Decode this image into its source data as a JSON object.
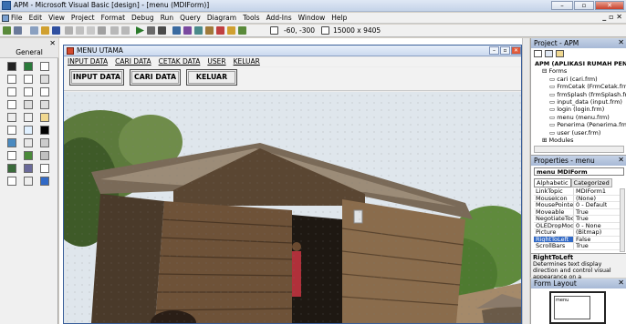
{
  "window": {
    "title": "APM - Microsoft Visual Basic [design] - [menu (MDIForm)]",
    "minimize": "–",
    "restore": "▫",
    "close": "✕"
  },
  "menubar": [
    "File",
    "Edit",
    "View",
    "Project",
    "Format",
    "Debug",
    "Run",
    "Query",
    "Diagram",
    "Tools",
    "Add-Ins",
    "Window",
    "Help"
  ],
  "toolbar": {
    "coords": "-60, -300",
    "size": "15000 x 9405"
  },
  "toolbox": {
    "title": "General"
  },
  "mdi": {
    "title": "MENU UTAMA",
    "menu": [
      "INPUT DATA",
      "CARI DATA",
      "CETAK DATA",
      "USER",
      "KELUAR"
    ],
    "buttons": [
      "INPUT DATA",
      "CARI DATA",
      "KELUAR"
    ]
  },
  "project": {
    "title": "Project - APM",
    "root": "APM (APLIKASI RUMAH PENERIMA...)",
    "forms_folder": "Forms",
    "forms": [
      "cari (cari.frm)",
      "FrmCetak (FrmCetak.frm)",
      "frmSplash (frmSplash.frm)",
      "input_data (input.frm)",
      "login (login.frm)",
      "menu (menu.frm)",
      "Penerima (Penerima.frm)",
      "user (user.frm)"
    ],
    "modules_folder": "Modules"
  },
  "properties": {
    "title": "Properties - menu",
    "object": "menu MDIForm",
    "tabs": [
      "Alphabetic",
      "Categorized"
    ],
    "rows": [
      {
        "k": "LinkTopic",
        "v": "MDIForm1"
      },
      {
        "k": "MouseIcon",
        "v": "(None)"
      },
      {
        "k": "MousePointer",
        "v": "0 - Default"
      },
      {
        "k": "Moveable",
        "v": "True"
      },
      {
        "k": "NegotiateToolbars",
        "v": "True"
      },
      {
        "k": "OLEDropMode",
        "v": "0 - None"
      },
      {
        "k": "Picture",
        "v": "(Bitmap)"
      },
      {
        "k": "RightToLeft",
        "v": "False"
      },
      {
        "k": "ScrollBars",
        "v": "True"
      }
    ],
    "desc_title": "RightToLeft",
    "desc_text": "Determines text display direction and control visual appearance on a"
  },
  "layout": {
    "title": "Form Layout",
    "form_label": "menu"
  },
  "colors": {
    "accent": "#3169c6",
    "panel_header": "#a7b9d6"
  }
}
